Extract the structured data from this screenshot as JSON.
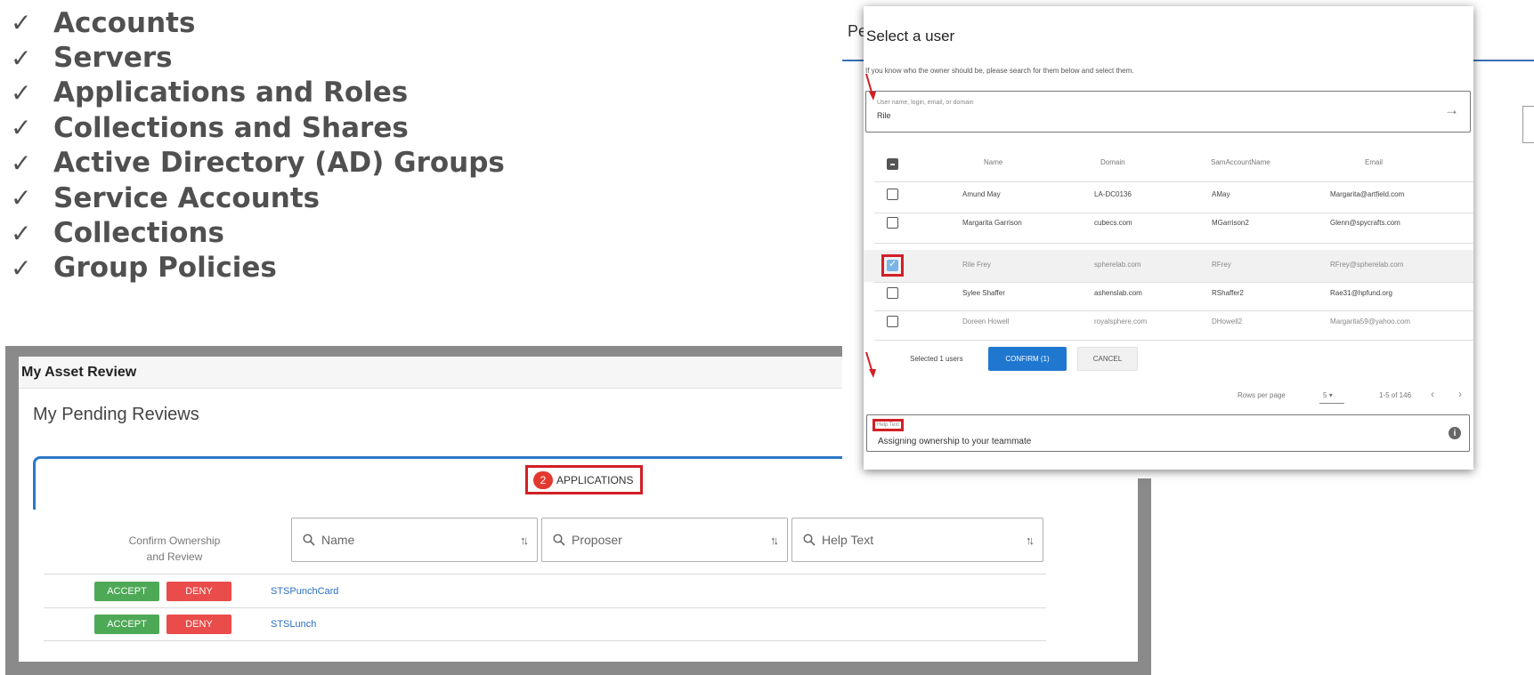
{
  "checklist": {
    "check_glyph": "✓",
    "items": [
      "Accounts",
      "Servers",
      "Applications and Roles",
      "Collections and Shares",
      "Active Directory (AD) Groups",
      "Service Accounts",
      "Collections",
      "Group Policies"
    ]
  },
  "asset_review": {
    "header": "My Asset Review",
    "pending_title": "My Pending Reviews",
    "tab": {
      "count": "2",
      "label": "APPLICATIONS"
    },
    "columns": {
      "confirm_line1": "Confirm Ownership",
      "confirm_line2": "and Review",
      "name_placeholder": "Name",
      "proposer_placeholder": "Proposer",
      "help_placeholder": "Help Text"
    },
    "accept_label": "ACCEPT",
    "deny_label": "DENY",
    "rows": [
      {
        "app": "STSPunchCard"
      },
      {
        "app": "STSLunch"
      }
    ],
    "accent": "#2e77c8",
    "accept_color": "#4ea956",
    "deny_color": "#e94c4a"
  },
  "dialog": {
    "backdrop_title": "Pe",
    "title": "Select a user",
    "instruction": "If you know who the owner should be, please search for them below and select them.",
    "search": {
      "placeholder": "User name, login, email, or domain",
      "value": "Rile"
    },
    "headers": [
      "Name",
      "Domain",
      "SamAccountName",
      "Email"
    ],
    "users": [
      {
        "name": "Amund May",
        "domain": "LA-DC0136",
        "sam": "AMay",
        "email": "Margarita@artfield.com",
        "checked": false
      },
      {
        "name": "Margarita Garrison",
        "domain": "cubecs.com",
        "sam": "MGarrison2",
        "email": "Glenn@spycrafts.com",
        "checked": false
      },
      {
        "name": "Rile Frey",
        "domain": "spherelab.com",
        "sam": "RFrey",
        "email": "RFrey@spherelab.com",
        "checked": true
      },
      {
        "name": "Sylee Shaffer",
        "domain": "ashenslab.com",
        "sam": "RShaffer2",
        "email": "Rae31@hpfund.org",
        "checked": false
      },
      {
        "name": "Doreen Howell",
        "domain": "royalsphere.com",
        "sam": "DHowell2",
        "email": "Margarita59@yahoo.com",
        "checked": false
      }
    ],
    "selected_text": "Selected 1 users",
    "confirm_label": "CONFIRM (1)",
    "cancel_label": "CANCEL",
    "pagination": {
      "rows_label": "Rows per page",
      "rows_value": "5",
      "range": "1-5 of 146"
    },
    "help": {
      "label": "Help Text",
      "text": "Assigning ownership to your teammate"
    },
    "highlight_color": "#d21f26",
    "confirm_color": "#1f77d0"
  }
}
